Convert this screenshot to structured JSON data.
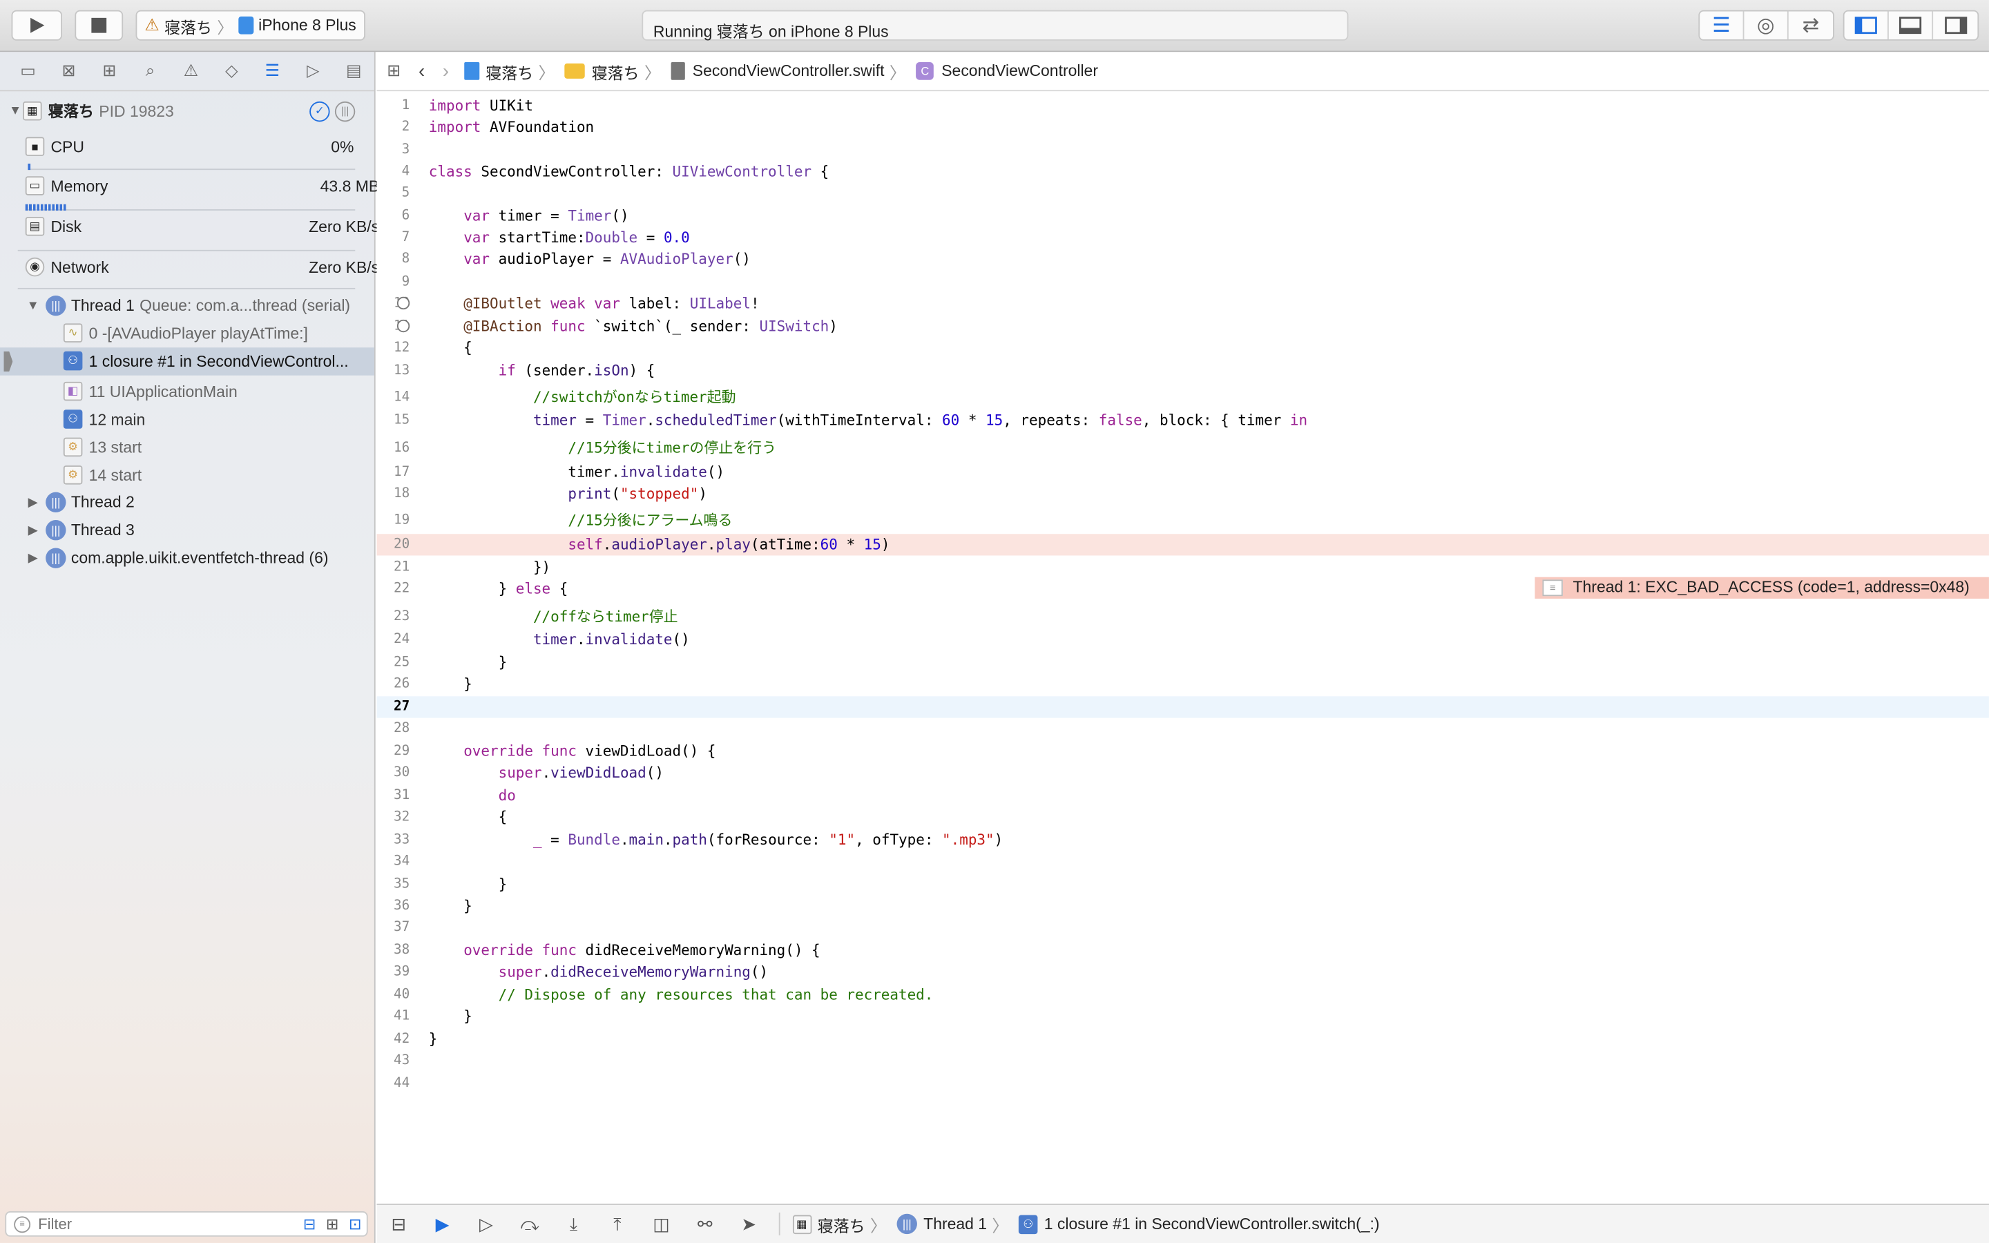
{
  "toolbar": {
    "scheme_app": "寝落ち",
    "scheme_device": "iPhone 8 Plus",
    "status": "Running 寝落ち on iPhone 8 Plus"
  },
  "navigator": {
    "process": "寝落ち",
    "pid": "PID 19823",
    "gauges": [
      {
        "label": "CPU",
        "value": "0%"
      },
      {
        "label": "Memory",
        "value": "43.8 MB"
      },
      {
        "label": "Disk",
        "value": "Zero KB/s"
      },
      {
        "label": "Network",
        "value": "Zero KB/s"
      }
    ],
    "thread1": "Thread 1",
    "thread1_queue": "Queue: com.a...thread (serial)",
    "frames": [
      "0 -[AVAudioPlayer playAtTime:]",
      "1 closure #1 in SecondViewControl...",
      "11 UIApplicationMain",
      "12 main",
      "13 start",
      "14 start"
    ],
    "threads": [
      "Thread 2",
      "Thread 3",
      "com.apple.uikit.eventfetch-thread (6)"
    ],
    "filter_placeholder": "Filter"
  },
  "jumpbar": {
    "items": [
      "寝落ち",
      "寝落ち",
      "SecondViewController.swift",
      "SecondViewController"
    ]
  },
  "editor": {
    "error_message": "Thread 1: EXC_BAD_ACCESS (code=1, address=0x48)",
    "current_line": "27"
  },
  "debugbar": {
    "items": [
      "寝落ち",
      "Thread 1",
      "1 closure #1 in SecondViewController.switch(_:)"
    ]
  }
}
